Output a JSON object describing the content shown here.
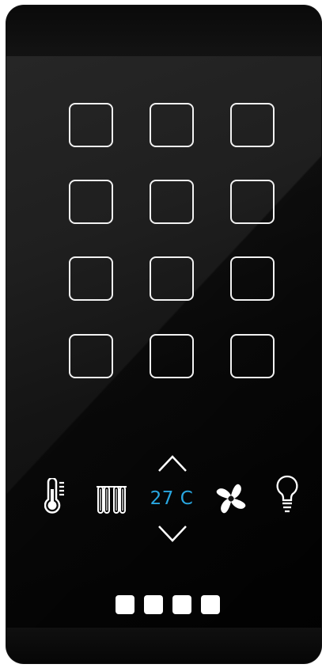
{
  "keypad": {
    "rows": 4,
    "columns": 3,
    "keys": [
      {
        "row": 1,
        "col": 1
      },
      {
        "row": 1,
        "col": 2
      },
      {
        "row": 1,
        "col": 3
      },
      {
        "row": 2,
        "col": 1
      },
      {
        "row": 2,
        "col": 2
      },
      {
        "row": 2,
        "col": 3
      },
      {
        "row": 3,
        "col": 1
      },
      {
        "row": 3,
        "col": 2
      },
      {
        "row": 3,
        "col": 3
      },
      {
        "row": 4,
        "col": 1
      },
      {
        "row": 4,
        "col": 2
      },
      {
        "row": 4,
        "col": 3
      }
    ]
  },
  "controls": {
    "thermometer_icon": "thermometer-icon",
    "heater_icon": "radiator-icon",
    "temperature": {
      "up_icon": "chevron-up-icon",
      "value": "27 C",
      "down_icon": "chevron-down-icon",
      "color": "#29a7e1"
    },
    "fan_icon": "fan-icon",
    "light_icon": "light-bulb-icon"
  },
  "pagination": {
    "pages": 4
  },
  "colors": {
    "panel": "#141414",
    "key_outline": "#f2f2f2",
    "accent": "#29a7e1"
  }
}
